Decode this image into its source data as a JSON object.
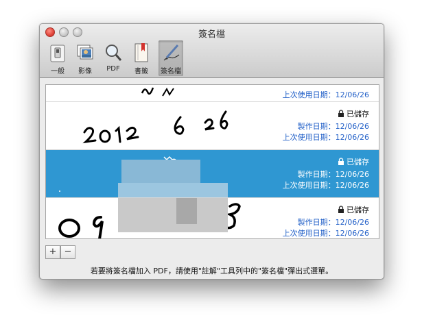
{
  "window": {
    "title": "簽名檔"
  },
  "toolbar": {
    "items": [
      {
        "label": "一般",
        "icon": "switch-icon"
      },
      {
        "label": "影像",
        "icon": "photos-icon"
      },
      {
        "label": "PDF",
        "icon": "magnifier-icon"
      },
      {
        "label": "書籤",
        "icon": "bookmark-icon"
      },
      {
        "label": "簽名檔",
        "icon": "pen-icon"
      }
    ],
    "selected": "簽名檔"
  },
  "signatures": [
    {
      "handwriting": "(partial signature)",
      "last_used": "上次使用日期：12/06/26"
    },
    {
      "handwriting": "2012 6 26",
      "status": "已儲存",
      "created": "製作日期：12/06/26",
      "last_used": "上次使用日期：12/06/26"
    },
    {
      "handwriting": "(redacted signature)",
      "status": "已儲存",
      "created": "製作日期：12/06/26",
      "last_used": "上次使用日期：12/06/26"
    },
    {
      "handwriting": "09… (redacted)",
      "status": "已儲存",
      "created": "製作日期：12/06/26",
      "last_used": "上次使用日期：12/06/26"
    }
  ],
  "buttons": {
    "add": "+",
    "remove": "−"
  },
  "hint": "若要將簽名檔加入 PDF，請使用\"註解\"工具列中的\"簽名檔\"彈出式選單。",
  "colors": {
    "selection": "#2f97d2",
    "meta_text": "#2260c8"
  }
}
